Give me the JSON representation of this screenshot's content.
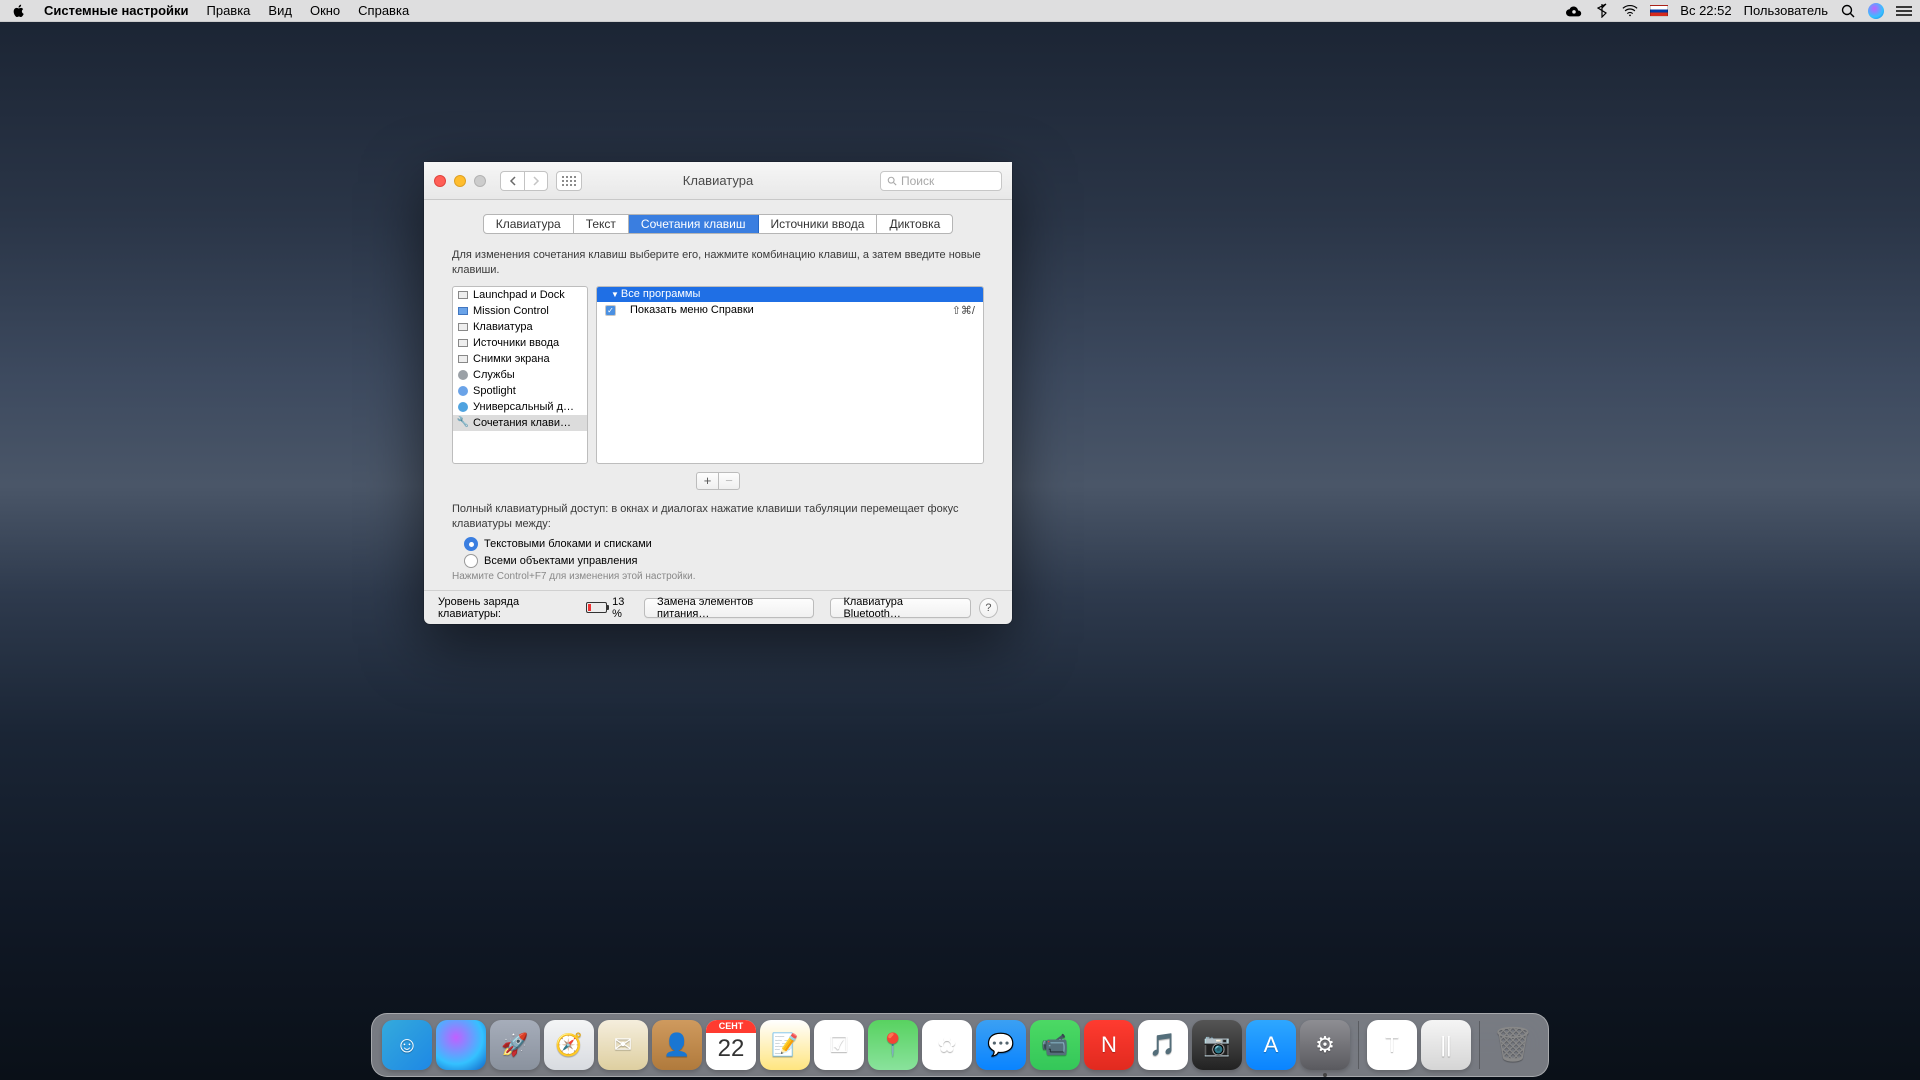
{
  "menubar": {
    "app": "Системные настройки",
    "items": [
      "Правка",
      "Вид",
      "Окно",
      "Справка"
    ],
    "clock": "Вс 22:52",
    "user": "Пользователь"
  },
  "window": {
    "title": "Клавиатура",
    "search_placeholder": "Поиск",
    "tabs": [
      "Клавиатура",
      "Текст",
      "Сочетания клавиш",
      "Источники ввода",
      "Диктовка"
    ],
    "active_tab_index": 2,
    "instruction": "Для изменения сочетания клавиш выберите его, нажмите комбинацию клавиш, а затем введите новые клавиши.",
    "categories": [
      {
        "label": "Launchpad и Dock"
      },
      {
        "label": "Mission Control"
      },
      {
        "label": "Клавиатура"
      },
      {
        "label": "Источники ввода"
      },
      {
        "label": "Снимки экрана"
      },
      {
        "label": "Службы"
      },
      {
        "label": "Spotlight"
      },
      {
        "label": "Универсальный д…"
      },
      {
        "label": "Сочетания клави…"
      }
    ],
    "selected_category_index": 8,
    "shortcut_group": "Все программы",
    "shortcuts": [
      {
        "enabled": true,
        "label": "Показать меню Справки",
        "keys": "⇧⌘/"
      }
    ],
    "kbaccess_text": "Полный клавиатурный доступ: в окнах и диалогах нажатие клавиши табуляции перемещает фокус клавиатуры между:",
    "radio1": "Текстовыми блоками и списками",
    "radio2": "Всеми объектами управления",
    "radio_selected": 0,
    "hint": "Нажмите Control+F7 для изменения этой настройки.",
    "footer": {
      "battery_label": "Уровень заряда клавиатуры:",
      "battery_pct": "13 %",
      "replace_btn": "Замена элементов питания…",
      "bt_btn": "Клавиатура Bluetooth…"
    }
  },
  "dock": {
    "apps": [
      {
        "name": "finder",
        "bg": "linear-gradient(135deg,#34aadc,#1e88e5)",
        "glyph": "☺"
      },
      {
        "name": "siri",
        "bg": "radial-gradient(circle at 40% 35%,#c160ff,#34c1ff 60%,#1163c6)",
        "glyph": ""
      },
      {
        "name": "launchpad",
        "bg": "linear-gradient(#a6adba,#8a929e)",
        "glyph": "🚀"
      },
      {
        "name": "safari",
        "bg": "linear-gradient(#f4f5f6,#d8dbe0)",
        "glyph": "🧭"
      },
      {
        "name": "mail",
        "bg": "linear-gradient(#f5eedd,#decfa0)",
        "glyph": "✉"
      },
      {
        "name": "contacts",
        "bg": "linear-gradient(#cf9a5e,#b07a3c)",
        "glyph": "👤"
      },
      {
        "name": "calendar",
        "bg": "#fff",
        "glyph": ""
      },
      {
        "name": "notes",
        "bg": "linear-gradient(#fff,#ffe57f)",
        "glyph": "📝"
      },
      {
        "name": "reminders",
        "bg": "#fff",
        "glyph": "☑"
      },
      {
        "name": "maps",
        "bg": "linear-gradient(#58d260,#89e29c)",
        "glyph": "📍"
      },
      {
        "name": "photos",
        "bg": "#fff",
        "glyph": "✿"
      },
      {
        "name": "messages",
        "bg": "linear-gradient(#3ba0f3,#0a84ff)",
        "glyph": "💬"
      },
      {
        "name": "facetime",
        "bg": "linear-gradient(#4cd964,#34c759)",
        "glyph": "📹"
      },
      {
        "name": "news",
        "bg": "linear-gradient(#ff3b30,#e12a1f)",
        "glyph": "N"
      },
      {
        "name": "itunes",
        "bg": "#fff",
        "glyph": "🎵"
      },
      {
        "name": "photobooth",
        "bg": "linear-gradient(#555,#222)",
        "glyph": "📷"
      },
      {
        "name": "appstore",
        "bg": "linear-gradient(#2ea7ff,#0a84ff)",
        "glyph": "A"
      },
      {
        "name": "preferences",
        "bg": "linear-gradient(#8e8e93,#5a5a5f)",
        "glyph": "⚙",
        "running": true
      }
    ],
    "right": [
      {
        "name": "textedit",
        "bg": "#fff",
        "glyph": "T"
      },
      {
        "name": "parallels",
        "bg": "linear-gradient(#f5f5f5,#d5d5d5)",
        "glyph": "||"
      }
    ],
    "trash": {
      "name": "trash",
      "bg": "transparent",
      "glyph": "🗑"
    },
    "calendar_month": "СЕНТ",
    "calendar_day": "22"
  }
}
